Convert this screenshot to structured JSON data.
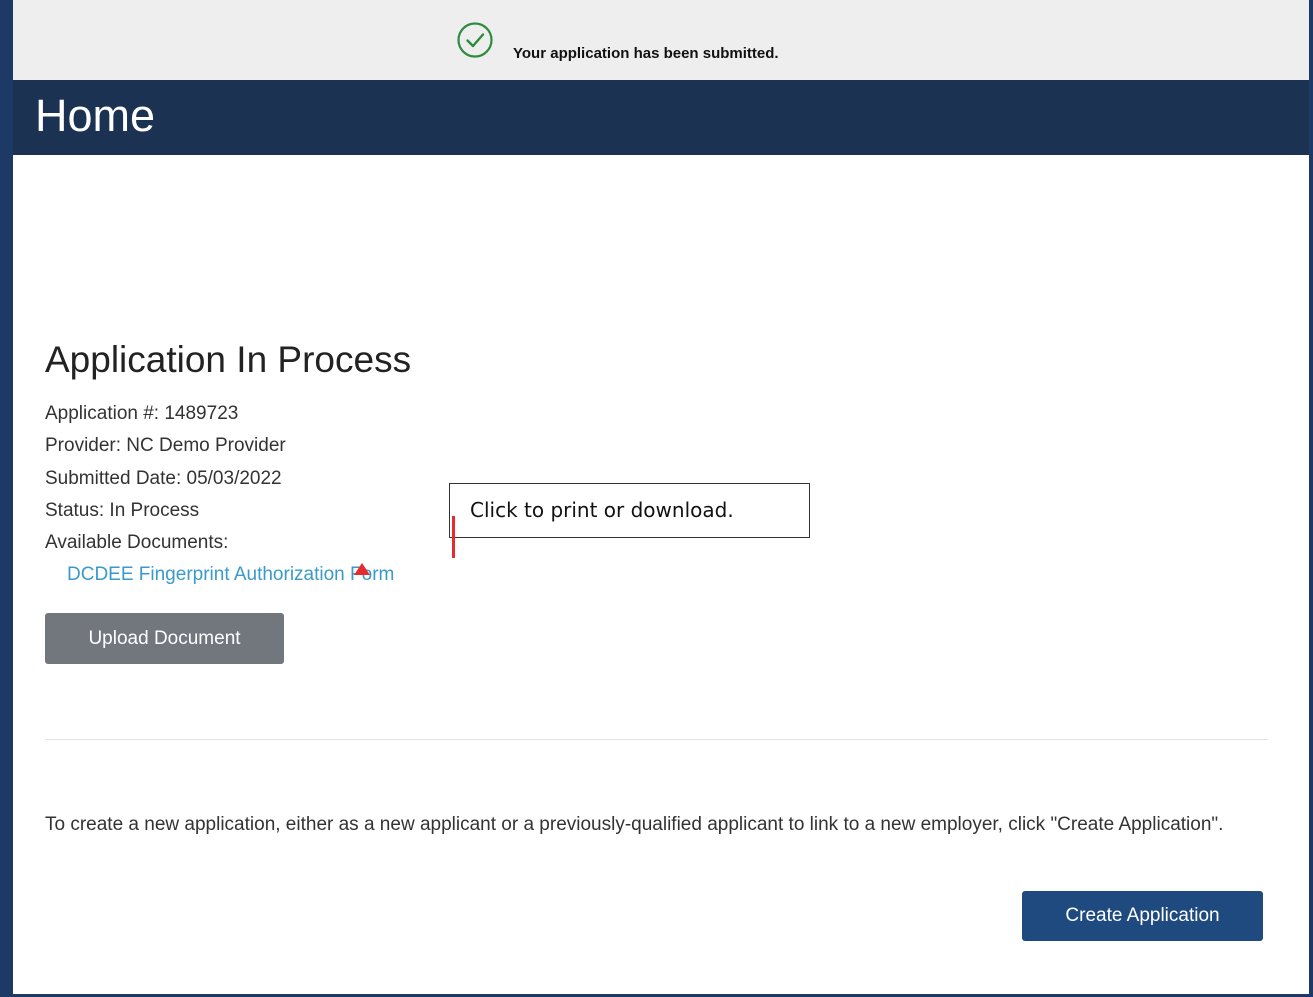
{
  "notice": {
    "icon": "check-circle-icon",
    "text": "Your application has been submitted."
  },
  "header": {
    "title": "Home"
  },
  "application": {
    "section_title": "Application In Process",
    "number_line": "Application #: 1489723",
    "provider_line": "Provider: NC Demo Provider",
    "submitted_line": "Submitted Date: 05/03/2022",
    "status_line": "Status: In Process",
    "documents_label": "Available Documents:",
    "documents": [
      {
        "label": "DCDEE Fingerprint Authorization Form"
      }
    ],
    "upload_button": "Upload Document"
  },
  "create": {
    "instruction": "To create a new application, either as a new applicant or a previously-qualified applicant to link to a new employer, click \"Create Application\".",
    "button": "Create Application"
  },
  "callout": {
    "text": "Click to print or download."
  },
  "colors": {
    "header": "#1b3253",
    "link": "#3a9ac9",
    "success": "#2e8b3e",
    "primary_button": "#1f4a80",
    "secondary_button": "#72767d",
    "annotation": "#e52b2b"
  }
}
